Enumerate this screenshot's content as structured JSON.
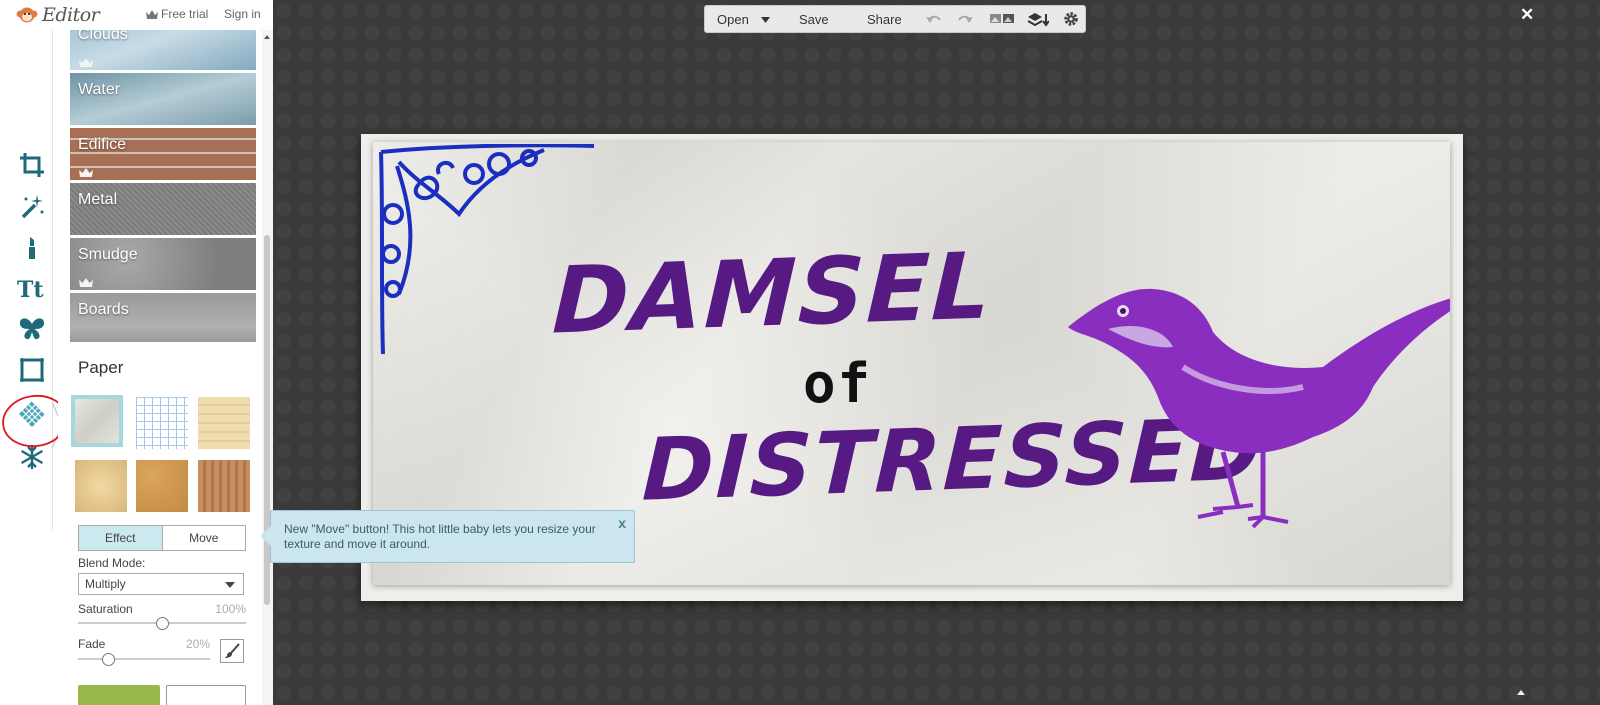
{
  "header": {
    "app_name": "Editor",
    "free_trial_label": "Free trial",
    "sign_in_label": "Sign in"
  },
  "toolbar": {
    "tools": [
      "crop-icon",
      "magic-wand-icon",
      "lipstick-icon",
      "text-icon",
      "butterfly-icon",
      "frame-icon",
      "texture-icon",
      "snowflake-icon"
    ],
    "active_tool": "texture-icon"
  },
  "textures": {
    "items": [
      {
        "label": "Clouds",
        "premium": true
      },
      {
        "label": "Water",
        "premium": false
      },
      {
        "label": "Edifice",
        "premium": true
      },
      {
        "label": "Metal",
        "premium": false
      },
      {
        "label": "Smudge",
        "premium": true
      },
      {
        "label": "Boards",
        "premium": false
      }
    ],
    "section_title": "Paper",
    "selected_swatch_index": 0
  },
  "controls": {
    "mode_tabs": [
      "Effect",
      "Move"
    ],
    "active_mode": "Effect",
    "blend_mode_label": "Blend Mode:",
    "blend_mode_value": "Multiply",
    "saturation_label": "Saturation",
    "saturation_value": "100%",
    "saturation_level": 1.0,
    "fade_label": "Fade",
    "fade_value": "20%",
    "fade_level": 0.2
  },
  "topbar": {
    "open_label": "Open",
    "save_label": "Save",
    "share_label": "Share",
    "close_label": "✕"
  },
  "tooltip": {
    "text": "New \"Move\" button! This hot little baby lets you resize your texture and move it around.",
    "close_label": "x"
  },
  "artwork": {
    "line1": "DAMSEL",
    "line2": "of",
    "line3": "DISTRESSED"
  },
  "colors": {
    "accent_teal": "#cbe6ee",
    "workspace_bg": "#3a3a3a",
    "art_purple": "#561a82",
    "bird_purple": "#8a2ec0",
    "ornament_blue": "#1a2fc0",
    "annotation_red": "#e0141c"
  }
}
